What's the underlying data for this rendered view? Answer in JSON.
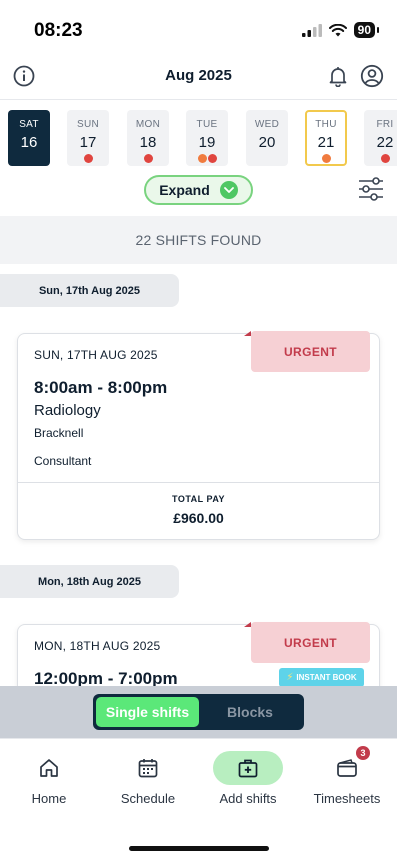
{
  "status_bar": {
    "time": "08:23",
    "battery": "90"
  },
  "header": {
    "title": "Aug 2025",
    "icons": [
      "info-icon",
      "bell-icon",
      "profile-icon"
    ]
  },
  "days": [
    {
      "dow": "SAT",
      "num": "16",
      "state": "selected",
      "dots": []
    },
    {
      "dow": "SUN",
      "num": "17",
      "state": "",
      "dots": [
        "#e0453f"
      ]
    },
    {
      "dow": "MON",
      "num": "18",
      "state": "",
      "dots": [
        "#e0453f"
      ]
    },
    {
      "dow": "TUE",
      "num": "19",
      "state": "",
      "dots": [
        "#f07b3f",
        "#e0453f"
      ]
    },
    {
      "dow": "WED",
      "num": "20",
      "state": "",
      "dots": []
    },
    {
      "dow": "THU",
      "num": "21",
      "state": "today",
      "dots": [
        "#f07b3f"
      ]
    },
    {
      "dow": "FRI",
      "num": "22",
      "state": "",
      "dots": [
        "#e0453f"
      ]
    }
  ],
  "expand": {
    "label": "Expand"
  },
  "results": {
    "text": "22 SHIFTS FOUND"
  },
  "groups": [
    {
      "date_tab": "Sun, 17th Aug 2025",
      "card": {
        "date": "SUN, 17TH AUG 2025",
        "badge": "URGENT",
        "time": "8:00am - 8:00pm",
        "specialty": "Radiology",
        "location": "Bracknell",
        "grade": "Consultant",
        "pay_label": "TOTAL PAY",
        "pay": "£960.00"
      }
    },
    {
      "date_tab": "Mon, 18th Aug 2025",
      "card": {
        "date": "MON, 18TH AUG 2025",
        "badge": "URGENT",
        "time": "12:00pm - 7:00pm",
        "instant_book": "INSTANT BOOK"
      }
    }
  ],
  "segment": {
    "active": "Single shifts",
    "inactive": "Blocks"
  },
  "nav": {
    "home": "Home",
    "schedule": "Schedule",
    "add_shifts": "Add shifts",
    "timesheets": "Timesheets",
    "timesheets_badge": "3"
  },
  "colors": {
    "brand_dark": "#0f2a3e",
    "accent_green": "#5be879",
    "urgent_bg": "#f6d0d4",
    "urgent_text": "#c23b4b",
    "instant_book": "#5ed3e9",
    "today_border": "#f2c94c"
  }
}
